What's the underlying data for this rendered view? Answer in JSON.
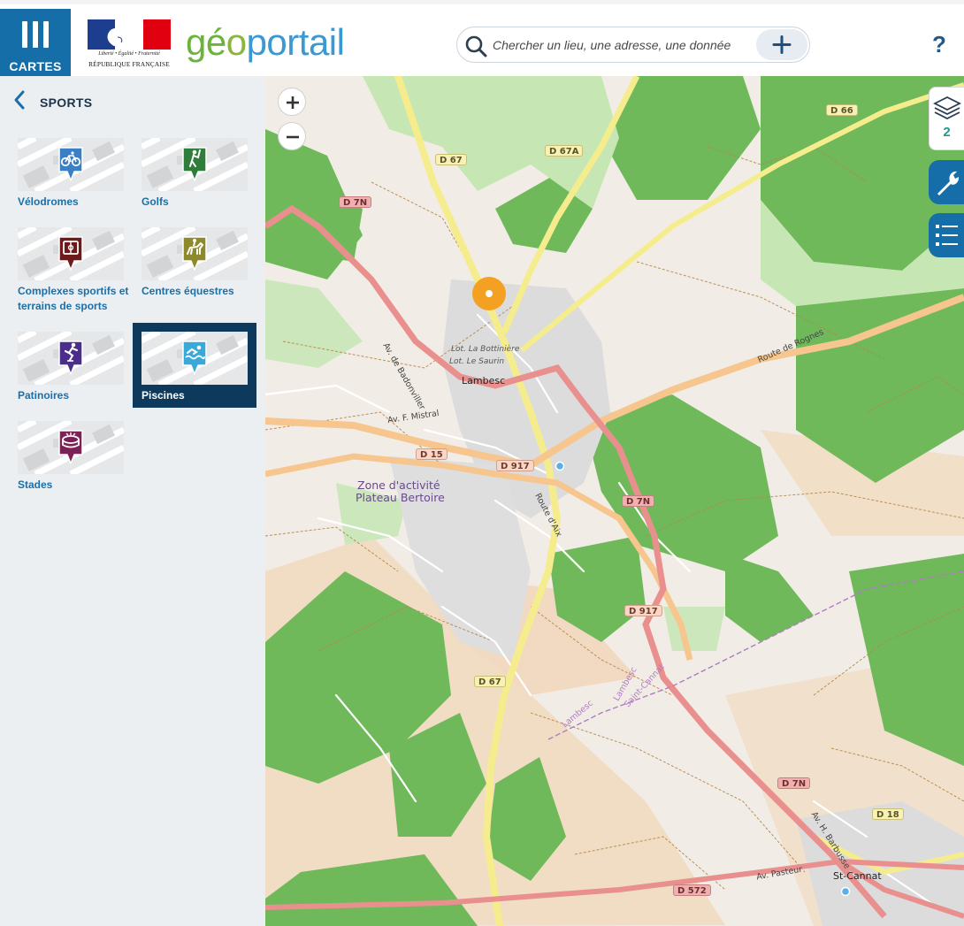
{
  "header": {
    "menu_label": "CARTES",
    "republic_motto": "Liberté • Égalité • Fraternité",
    "republic_name": "RÉPUBLIQUE FRANÇAISE",
    "logo_part1": "gé",
    "logo_part2": "o",
    "logo_part3": "portail",
    "search_placeholder": "Chercher un lieu, une adresse, une donnée",
    "help_label": "?"
  },
  "sidebar": {
    "title": "SPORTS",
    "tiles": [
      {
        "label": "Vélodromes",
        "icon": "bicycle-icon",
        "color": "#3b7fc4",
        "selected": false
      },
      {
        "label": "Golfs",
        "icon": "golfer-icon",
        "color": "#2f7d3a",
        "selected": false
      },
      {
        "label": "Complexes sportifs et terrains de sports",
        "icon": "sports-field-icon",
        "color": "#6e1a1a",
        "selected": false
      },
      {
        "label": "Centres équestres",
        "icon": "horse-rider-icon",
        "color": "#8e8a2c",
        "selected": false
      },
      {
        "label": "Patinoires",
        "icon": "skater-icon",
        "color": "#4b2d8c",
        "selected": false
      },
      {
        "label": "Piscines",
        "icon": "swimmer-icon",
        "color": "#38a9d9",
        "selected": true
      },
      {
        "label": "Stades",
        "icon": "stadium-icon",
        "color": "#7b2155",
        "selected": false
      }
    ]
  },
  "map": {
    "layers_count": "2",
    "places": [
      {
        "label": "Lambesc"
      },
      {
        "label": "St-Cannat"
      },
      {
        "label": "Zone d'activité"
      },
      {
        "label": "Plateau Bertoire"
      },
      {
        "label": "Lot. La Bottinière"
      },
      {
        "label": "Lot. Le Saurin"
      }
    ],
    "streets": [
      {
        "label": "Av. de Badonviller"
      },
      {
        "label": "Av. F. Mistral"
      },
      {
        "label": "Route d'Aix"
      },
      {
        "label": "Route de Rognes"
      },
      {
        "label": "Av. H. Barbusse"
      },
      {
        "label": "Av. Pasteur"
      },
      {
        "label": "Lambesc"
      },
      {
        "label": "Saint-Cannat"
      },
      {
        "label": "Lambesc"
      }
    ],
    "road_tags": [
      {
        "label": "D 66"
      },
      {
        "label": "D 67"
      },
      {
        "label": "D 67A"
      },
      {
        "label": "D 7N"
      },
      {
        "label": "D 15"
      },
      {
        "label": "D 917"
      },
      {
        "label": "D 7N"
      },
      {
        "label": "D 917"
      },
      {
        "label": "D 67"
      },
      {
        "label": "D 7N"
      },
      {
        "label": "D 18"
      },
      {
        "label": "D 572"
      }
    ]
  }
}
